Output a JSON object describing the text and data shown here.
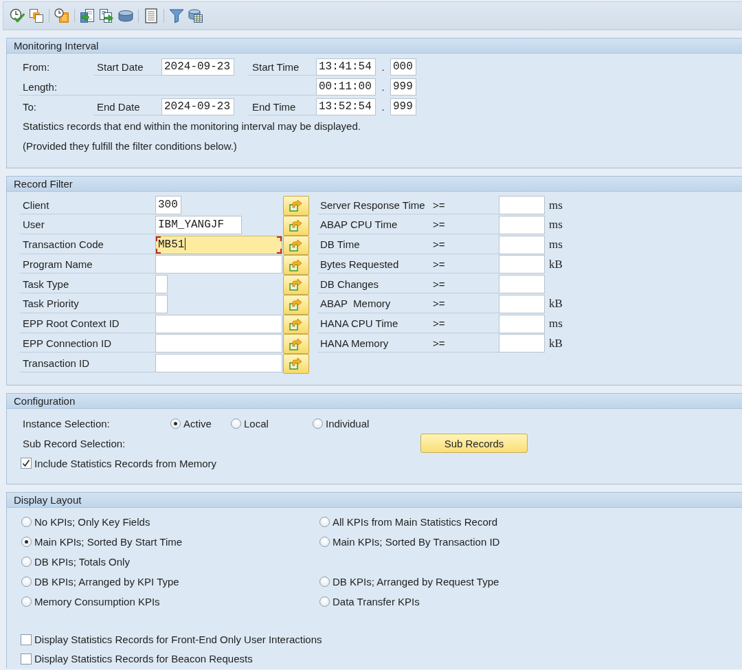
{
  "monitoring_interval": {
    "title": "Monitoring Interval",
    "rows": [
      {
        "label": "From:",
        "date_label": "Start Date",
        "date": "2024-09-23",
        "time_label": "Start Time",
        "time": "13:41:54",
        "separator": ".",
        "milliseconds": "000"
      },
      {
        "label": "Length:",
        "time": "00:11:00",
        "separator": ".",
        "milliseconds": "999"
      },
      {
        "label": "To:",
        "date_label": "End Date",
        "date": "2024-09-23",
        "time_label": "End Time",
        "time": "13:52:54",
        "separator": ".",
        "milliseconds": "999"
      }
    ],
    "notes": [
      "Statistics records that end within the monitoring interval may be displayed.",
      "(Provided they fulfill the filter conditions below.)"
    ]
  },
  "record_filter": {
    "title": "Record Filter",
    "fields": [
      {
        "label": "Client",
        "value": "300",
        "focused": false
      },
      {
        "label": "User",
        "value": "IBM_YANGJF",
        "focused": false
      },
      {
        "label": "Transaction Code",
        "value": "MB51",
        "focused": true
      },
      {
        "label": "Program Name",
        "focused": false
      },
      {
        "label": "Task Type",
        "focused": false
      },
      {
        "label": "Task Priority",
        "focused": false
      },
      {
        "label": "EPP Root Context ID",
        "focused": false
      },
      {
        "label": "EPP Connection ID",
        "focused": false
      },
      {
        "label": "Transaction ID",
        "focused": false
      }
    ],
    "thresholds": [
      {
        "label": "Server Response Time",
        "operator": ">=",
        "unit": "ms"
      },
      {
        "label": "ABAP CPU Time",
        "operator": ">=",
        "unit": "ms"
      },
      {
        "label": "DB Time",
        "operator": ">=",
        "unit": "ms"
      },
      {
        "label": "Bytes Requested",
        "operator": ">=",
        "unit": "kB"
      },
      {
        "label": "DB Changes",
        "operator": ">="
      },
      {
        "label": "ABAP  Memory",
        "operator": ">=",
        "unit": "kB"
      },
      {
        "label": "HANA CPU Time",
        "operator": ">=",
        "unit": "ms"
      },
      {
        "label": "HANA Memory",
        "operator": ">=",
        "unit": "kB"
      }
    ]
  },
  "configuration": {
    "title": "Configuration",
    "instance_selection": {
      "label": "Instance Selection:",
      "options": [
        {
          "label": "Active",
          "selected": true
        },
        {
          "label": "Local",
          "selected": false
        },
        {
          "label": "Individual",
          "selected": false
        }
      ]
    },
    "sub_record_selection": {
      "label": "Sub Record Selection:",
      "button": "Sub Records"
    },
    "include_memory": {
      "label": "Include Statistics Records from Memory",
      "checked": true
    }
  },
  "display_layout": {
    "title": "Display Layout",
    "rows": [
      {
        "options": [
          {
            "label": "No KPIs; Only Key Fields",
            "selected": false
          },
          {
            "label": "All KPIs from Main Statistics Record",
            "selected": false
          }
        ]
      },
      {
        "options": [
          {
            "label": "Main KPIs; Sorted By Start Time",
            "selected": true
          },
          {
            "label": "Main KPIs; Sorted By Transaction ID",
            "selected": false
          }
        ]
      },
      {
        "options": [
          {
            "label": "DB KPIs; Totals Only",
            "selected": false
          }
        ]
      },
      {
        "options": [
          {
            "label": "DB KPIs; Arranged by KPI Type",
            "selected": false
          },
          {
            "label": "DB KPIs; Arranged by Request Type",
            "selected": false
          }
        ]
      },
      {
        "options": [
          {
            "label": "Memory Consumption KPIs",
            "selected": false
          },
          {
            "label": "Data Transfer KPIs",
            "selected": false
          }
        ]
      }
    ],
    "checkboxes": [
      {
        "label": "Display Statistics Records for Front-End Only User Interactions",
        "checked": false
      },
      {
        "label": "Display Statistics Records for Beacon Requests",
        "checked": false
      }
    ]
  }
}
